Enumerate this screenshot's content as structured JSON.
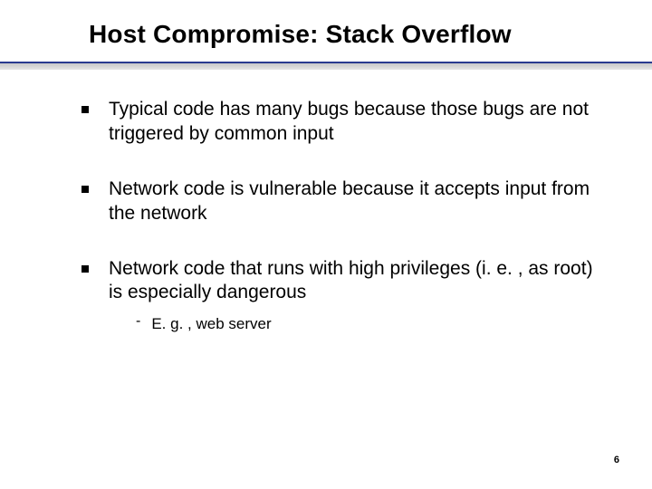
{
  "title": "Host Compromise: Stack Overflow",
  "bullets": [
    {
      "text": "Typical code has many bugs because those bugs are not triggered by common input"
    },
    {
      "text": "Network code is vulnerable because it accepts input from the network"
    },
    {
      "text": "Network code that runs with high privileges (i. e. , as root) is especially dangerous",
      "sub": {
        "text": "E. g. , web server"
      }
    }
  ],
  "pageNumber": "6"
}
